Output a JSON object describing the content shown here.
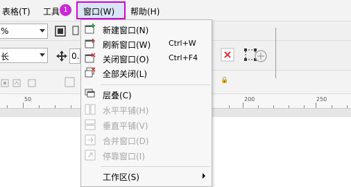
{
  "menubar": {
    "table_menu": "表格(T)",
    "tools_menu": "工具",
    "window_menu": "窗口(W)",
    "help_menu": "帮助(H)",
    "step_badge": "1"
  },
  "toolbar": {
    "zoom_value": "%",
    "font_combo_value": "长",
    "coord_value": "0.",
    "lock_symbol": "🔒"
  },
  "ruler": {
    "labels": [
      "50",
      "200",
      "250"
    ]
  },
  "window_dropdown": {
    "items": [
      {
        "label": "新建窗口(N)",
        "shortcut": "",
        "enabled": true,
        "icon": "new-window-icon"
      },
      {
        "label": "刷新窗口(W)",
        "shortcut": "Ctrl+W",
        "enabled": true,
        "icon": "refresh-window-icon"
      },
      {
        "label": "关闭窗口(O)",
        "shortcut": "Ctrl+F4",
        "enabled": true,
        "icon": "close-window-icon"
      },
      {
        "label": "全部关闭(L)",
        "shortcut": "",
        "enabled": true,
        "icon": "close-all-icon"
      },
      {
        "label": "层叠(C)",
        "shortcut": "",
        "enabled": true,
        "icon": "cascade-icon"
      },
      {
        "label": "水平平铺(H)",
        "shortcut": "",
        "enabled": false,
        "icon": "tile-horizontal-icon"
      },
      {
        "label": "垂直平铺(V)",
        "shortcut": "",
        "enabled": false,
        "icon": "tile-vertical-icon"
      },
      {
        "label": "合并窗口(D)",
        "shortcut": "",
        "enabled": false,
        "icon": "merge-window-icon"
      },
      {
        "label": "停靠窗口(I)",
        "shortcut": "",
        "enabled": false,
        "icon": "dock-window-icon"
      },
      {
        "label": "工作区(S)",
        "shortcut": "",
        "enabled": true,
        "icon": ""
      }
    ]
  },
  "colors": {
    "highlight_border": "#d400d4",
    "badge": "#c929d6",
    "disabled_text": "#a6a6a6",
    "icon_red": "#e03030",
    "icon_green": "#2ea043"
  }
}
